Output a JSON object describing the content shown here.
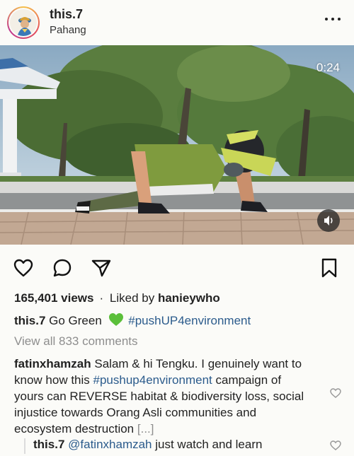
{
  "post": {
    "username": "this.7",
    "location": "Pahang",
    "video_time": "0:24",
    "views": "165,401 views",
    "separator": "·",
    "liked_by_prefix": "Liked by",
    "liked_by_user": "hanieywho",
    "caption": {
      "user": "this.7",
      "text": "Go Green",
      "emoji": "green-heart",
      "hashtag": "#pushUP4environment"
    },
    "view_all_comments": "View all 833 comments"
  },
  "comment": {
    "user": "fatinxhamzah",
    "text_before_tag": "Salam & hi Tengku. I genuinely want to know how this",
    "hashtag": "#pushup4environment",
    "text_after_tag": "campaign of yours can REVERSE habitat & biodiversity loss, social injustice towards Orang Asli communities and ecosystem destruction",
    "more": "[...]"
  },
  "reply": {
    "user": "this.7",
    "mention": "@fatinxhamzah",
    "text": "just watch and learn"
  },
  "icons": {
    "more": "more-horizontal-icon",
    "like": "heart-outline-icon",
    "comment": "comment-bubble-icon",
    "share": "paper-plane-icon",
    "save": "bookmark-icon",
    "sound": "speaker-icon"
  },
  "colors": {
    "hashtag": "#2b5b8c",
    "muted": "#8e8e8e",
    "green_heart": "#5bbf3a"
  }
}
